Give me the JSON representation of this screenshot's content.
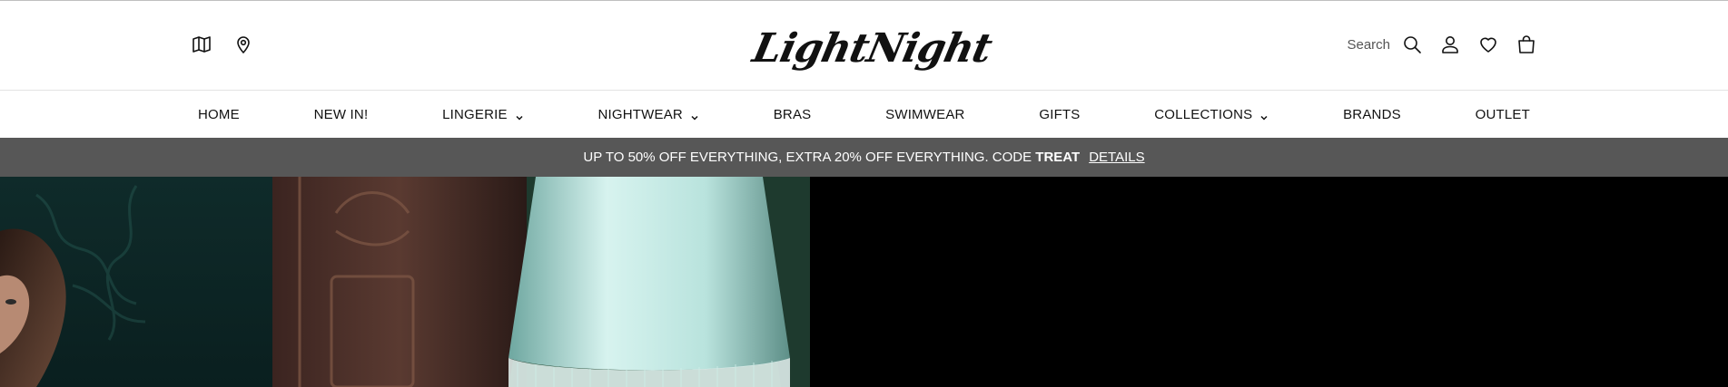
{
  "header": {
    "logo_text": "LightNight",
    "search_label": "Search",
    "left_icons": [
      "map-icon",
      "location-pin-icon"
    ],
    "right_icons": [
      "search-icon",
      "account-icon",
      "wishlist-heart-icon",
      "shopping-bag-icon"
    ]
  },
  "nav": {
    "items": [
      {
        "label": "HOME",
        "dropdown": false
      },
      {
        "label": "NEW IN!",
        "dropdown": false
      },
      {
        "label": "LINGERIE",
        "dropdown": true
      },
      {
        "label": "NIGHTWEAR",
        "dropdown": true
      },
      {
        "label": "BRAS",
        "dropdown": false
      },
      {
        "label": "SWIMWEAR",
        "dropdown": false
      },
      {
        "label": "GIFTS",
        "dropdown": false
      },
      {
        "label": "COLLECTIONS",
        "dropdown": true
      },
      {
        "label": "BRANDS",
        "dropdown": false
      },
      {
        "label": "OUTLET",
        "dropdown": false
      }
    ]
  },
  "promo": {
    "text": "UP TO 50% OFF EVERYTHING, EXTRA 20% OFF EVERYTHING. CODE",
    "code": "TREAT",
    "link_label": "DETAILS"
  },
  "colors": {
    "promo_bg": "#575757",
    "hero_bg": "#000000",
    "text": "#111111"
  }
}
